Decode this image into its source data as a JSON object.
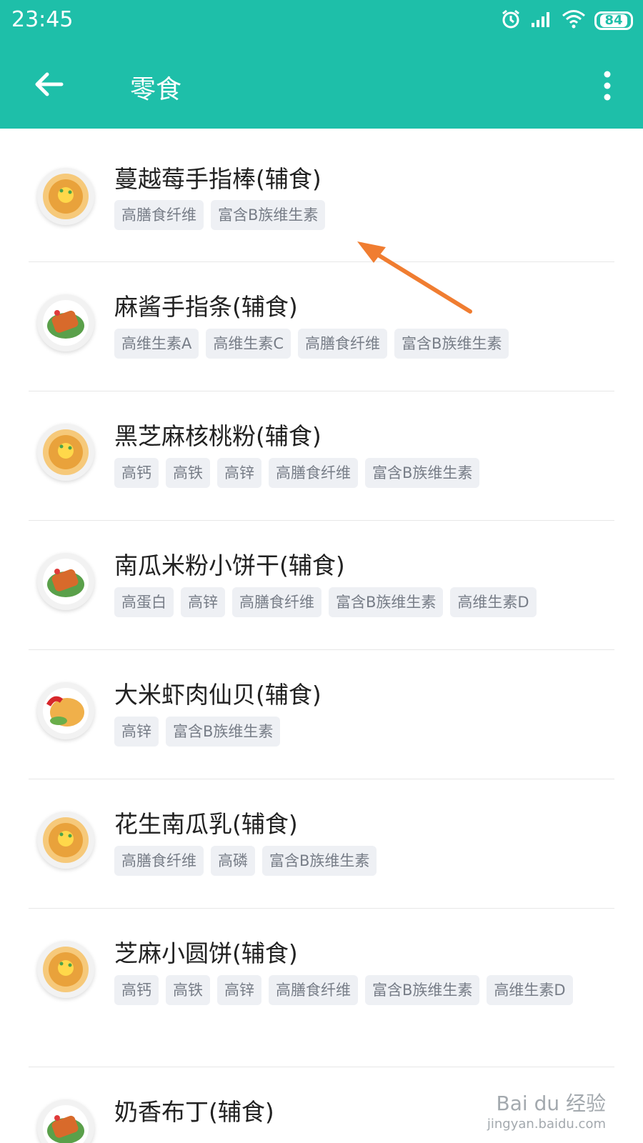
{
  "status_bar": {
    "time": "23:45",
    "battery": "84",
    "alarm_icon": "alarm-icon",
    "signal_icon": "signal-icon",
    "wifi_icon": "wifi-icon"
  },
  "toolbar": {
    "back_icon": "arrow-left-icon",
    "title": "零食",
    "more_icon": "more-vertical-icon"
  },
  "colors": {
    "accent": "#1ebfa9",
    "tag_bg": "#eef0f4",
    "tag_text": "#777d87",
    "annotation_arrow": "#f07d31"
  },
  "items": [
    {
      "name": "蔓越莓手指棒(辅食)",
      "thumb": "noodle-dish-icon",
      "tags": [
        "高膳食纤维",
        "富含B族维生素"
      ]
    },
    {
      "name": "麻酱手指条(辅食)",
      "thumb": "meat-salad-dish-icon",
      "tags": [
        "高维生素A",
        "高维生素C",
        "高膳食纤维",
        "富含B族维生素"
      ]
    },
    {
      "name": "黑芝麻核桃粉(辅食)",
      "thumb": "noodle-dish-icon",
      "tags": [
        "高钙",
        "高铁",
        "高锌",
        "高膳食纤维",
        "富含B族维生素"
      ]
    },
    {
      "name": "南瓜米粉小饼干(辅食)",
      "thumb": "meat-salad-dish-icon",
      "tags": [
        "高蛋白",
        "高锌",
        "高膳食纤维",
        "富含B族维生素",
        "高维生素D"
      ]
    },
    {
      "name": "大米虾肉仙贝(辅食)",
      "thumb": "egg-salad-dish-icon",
      "tags": [
        "高锌",
        "富含B族维生素"
      ]
    },
    {
      "name": "花生南瓜乳(辅食)",
      "thumb": "noodle-dish-icon",
      "tags": [
        "高膳食纤维",
        "高磷",
        "富含B族维生素"
      ]
    },
    {
      "name": "芝麻小圆饼(辅食)",
      "thumb": "noodle-dish-icon",
      "tags": [
        "高钙",
        "高铁",
        "高锌",
        "高膳食纤维",
        "富含B族维生素",
        "高维生素D"
      ]
    },
    {
      "name": "奶香布丁(辅食)",
      "thumb": "meat-salad-dish-icon",
      "tags": []
    }
  ],
  "watermark": {
    "brand": "Bai du 经验",
    "url": "jingyan.baidu.com"
  }
}
